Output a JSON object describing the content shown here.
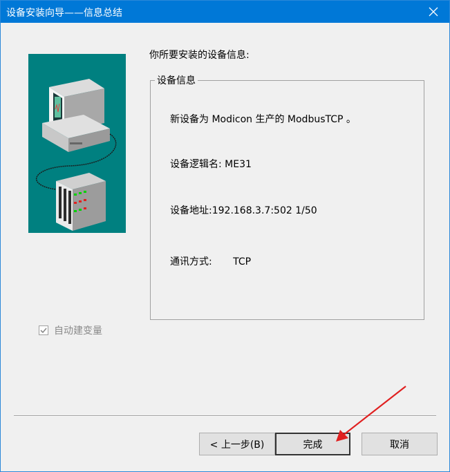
{
  "window": {
    "title": "设备安装向导——信息总结"
  },
  "heading": "你所要安装的设备信息:",
  "group": {
    "legend": "设备信息",
    "line1": "新设备为 Modicon 生产的 ModbusTCP 。",
    "line2": "设备逻辑名: ME31",
    "line3": "设备地址:192.168.3.7:502 1/50",
    "line4_label": "通讯方式:",
    "line4_value": "TCP"
  },
  "auto_create_variable": {
    "label": "自动建变量",
    "checked": true,
    "enabled": false
  },
  "buttons": {
    "back": "< 上一步(B)",
    "finish": "完成",
    "cancel": "取消"
  },
  "colors": {
    "titlebar": "#0078d7",
    "illustration_bg": "#008080",
    "annotation_arrow": "#e02020"
  },
  "icons": {
    "close": "close-icon",
    "illustration": "computer-device-illustration",
    "annotation": "red-arrow-annotation"
  }
}
